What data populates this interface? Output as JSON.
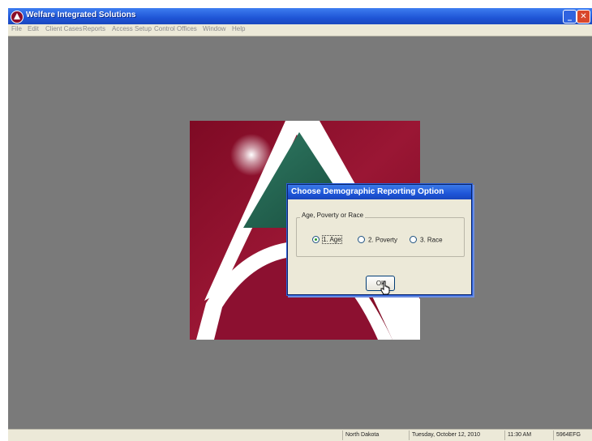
{
  "window": {
    "title": "Welfare Integrated Solutions",
    "minimize_glyph": "_",
    "close_glyph": "✕"
  },
  "menu": [
    "File",
    "Edit",
    "Client Cases",
    "Reports",
    "Access Setup",
    "Control Offices",
    "Window",
    "Help"
  ],
  "dialog": {
    "title": "Choose Demographic Reporting Option",
    "group_label": "Age, Poverty or Race",
    "options": [
      {
        "label": "1. Age",
        "checked": true
      },
      {
        "label": "2. Poverty",
        "checked": false
      },
      {
        "label": "3. Race",
        "checked": false
      }
    ],
    "ok_label": "Ok"
  },
  "status": {
    "ready": "",
    "state": "North Dakota",
    "date": "Tuesday, October 12, 2010",
    "time": "11:30 AM",
    "id": "5964EFG"
  },
  "colors": {
    "logo_red": "#8b0d2a",
    "logo_green": "#1e5c4a",
    "desktop_gray": "#7a7a7a",
    "xp_blue": "#1f55d6"
  }
}
